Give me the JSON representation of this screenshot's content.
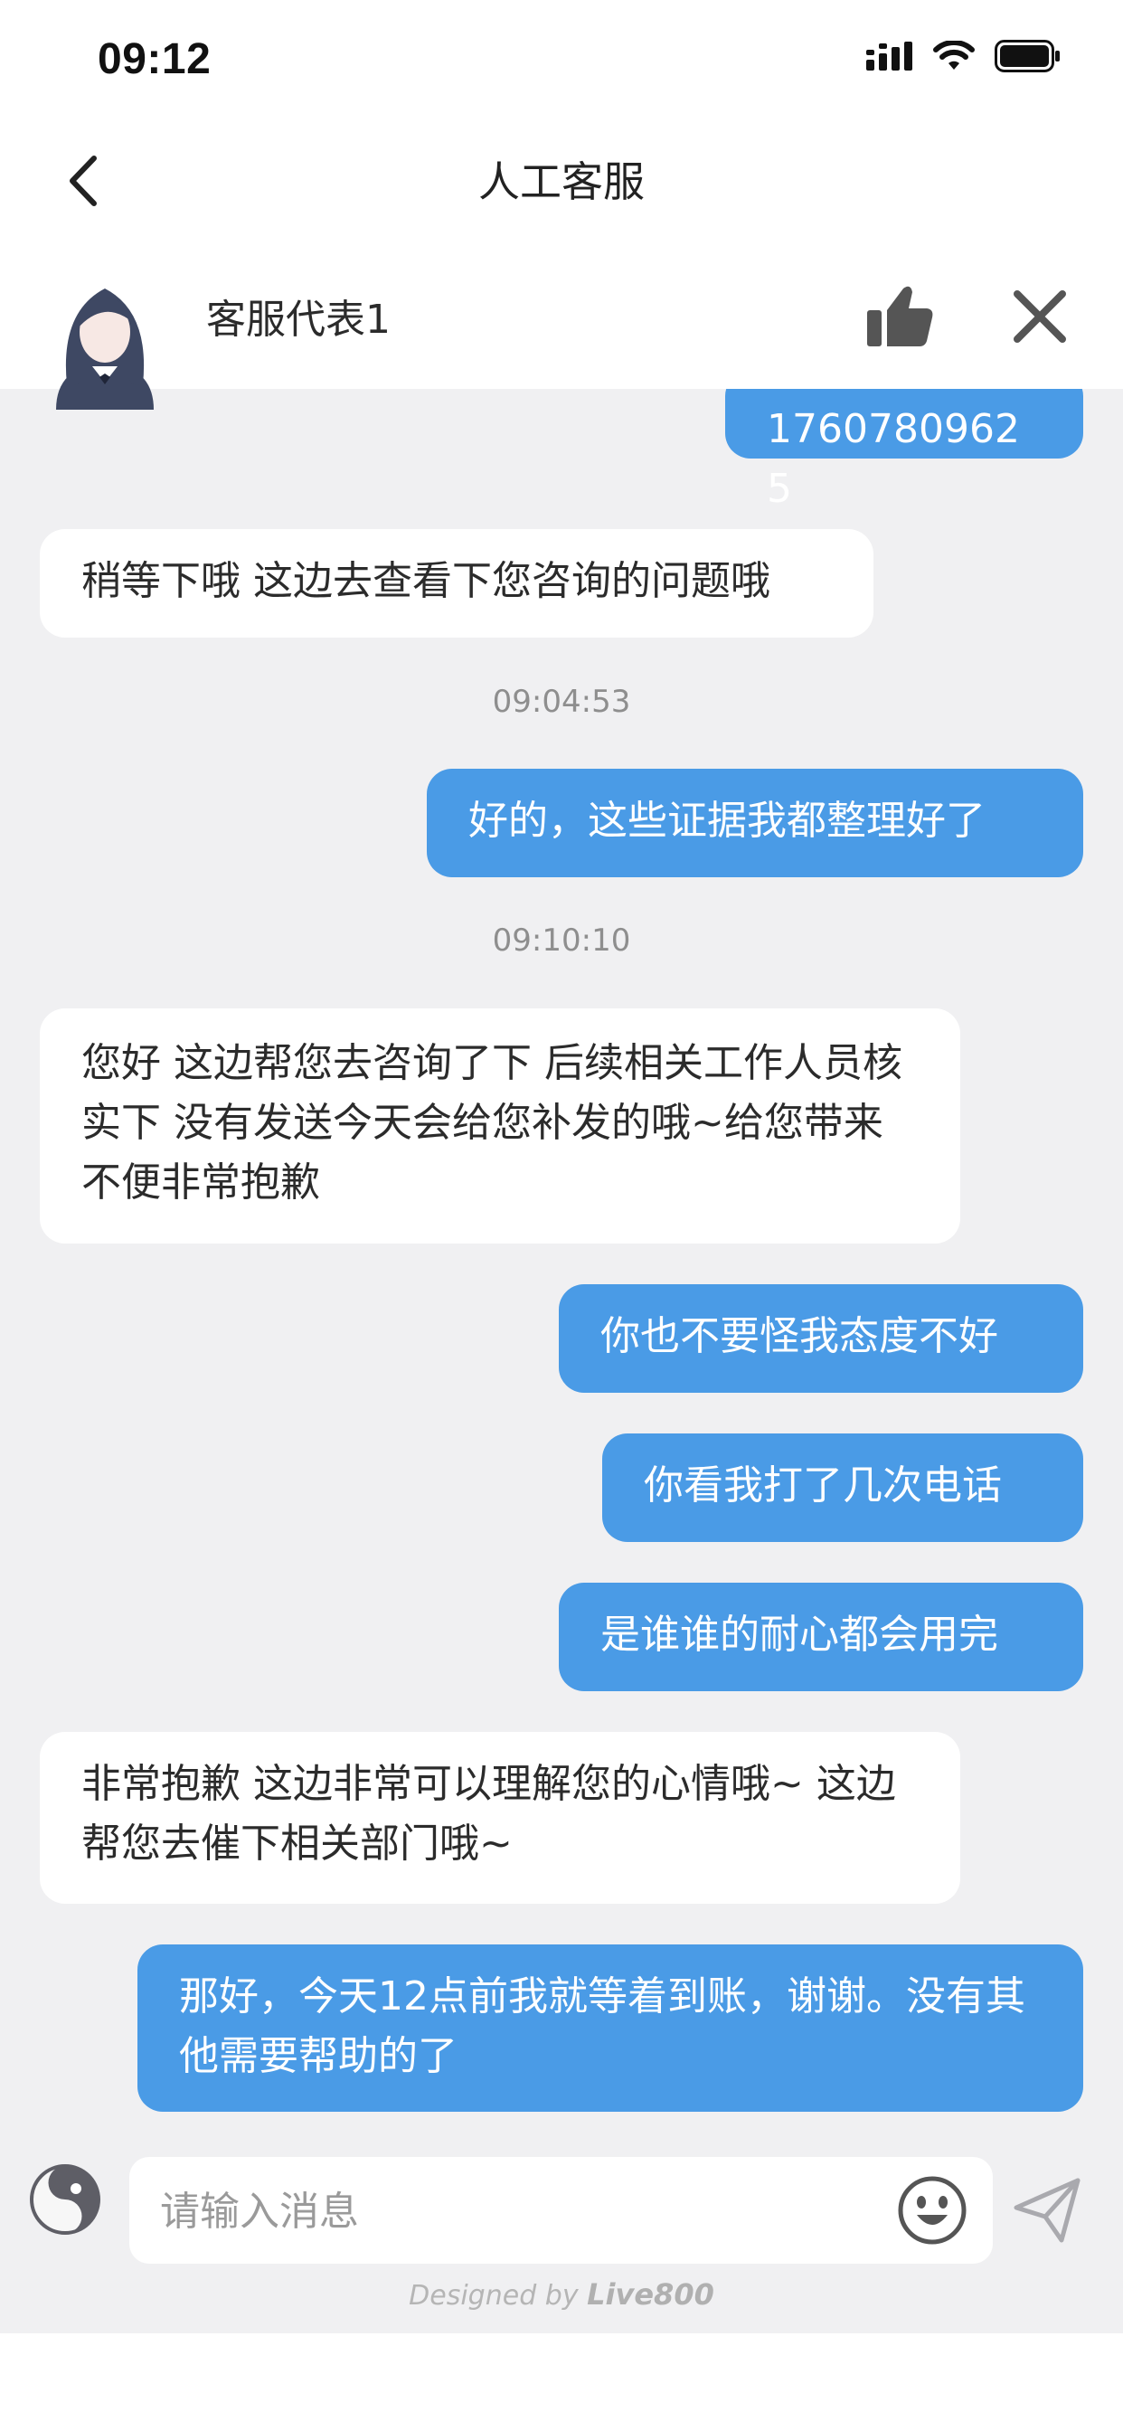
{
  "status_bar": {
    "time": "09:12"
  },
  "nav": {
    "title": "人工客服"
  },
  "agent": {
    "name": "客服代表1"
  },
  "messages": [
    {
      "side": "out",
      "text": "17607809625"
    },
    {
      "side": "in",
      "text": "稍等下哦 这边去查看下您咨询的问题哦"
    },
    {
      "side": "time",
      "text": "09:04:53"
    },
    {
      "side": "out",
      "text": "好的，这些证据我都整理好了"
    },
    {
      "side": "time",
      "text": "09:10:10"
    },
    {
      "side": "in",
      "text": "您好 这边帮您去咨询了下 后续相关工作人员核实下 没有发送今天会给您补发的哦~给您带来不便非常抱歉"
    },
    {
      "side": "out",
      "text": "你也不要怪我态度不好"
    },
    {
      "side": "out",
      "text": "你看我打了几次电话"
    },
    {
      "side": "out",
      "text": "是谁谁的耐心都会用完"
    },
    {
      "side": "in",
      "text": "非常抱歉 这边非常可以理解您的心情哦~ 这边帮您去催下相关部门哦~"
    },
    {
      "side": "out",
      "text": "那好，今天12点前我就等着到账，谢谢。没有其他需要帮助的了"
    }
  ],
  "input": {
    "placeholder": "请输入消息",
    "value": ""
  },
  "footer": {
    "designed_by": "Designed by",
    "brand": "Live800"
  },
  "icons": {
    "back": "chevron-left-icon",
    "like": "thumbs-up-icon",
    "close": "close-icon",
    "theme": "yin-yang-icon",
    "emoji": "emoji-icon",
    "send": "send-icon"
  },
  "colors": {
    "outgoing_bubble": "#4a9be6",
    "incoming_bubble": "#ffffff",
    "chat_background": "#f0f0f2",
    "icon_gray": "#555555"
  }
}
